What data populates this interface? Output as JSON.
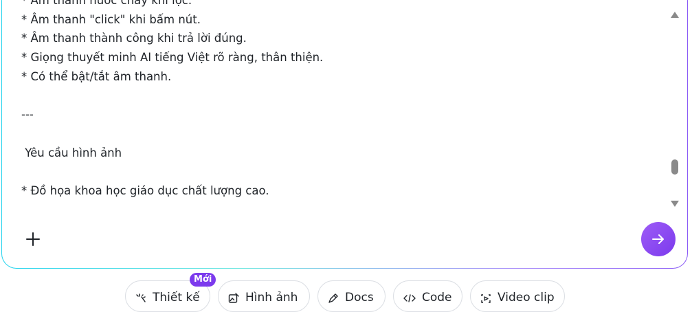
{
  "composer": {
    "lines": [
      "* Âm thanh nước chảy khi lọc.",
      "* Âm thanh \"click\" khi bấm nút.",
      "* Âm thanh thành công khi trả lời đúng.",
      "* Giọng thuyết minh AI tiếng Việt rõ ràng, thân thiện.",
      "* Có thể bật/tắt âm thanh.",
      "",
      "---",
      "",
      " Yêu cầu hình ảnh",
      "",
      "* Đồ họa khoa học giáo dục chất lượng cao."
    ],
    "accent_color": "#7c3aed"
  },
  "chips": [
    {
      "label": "Thiết kế",
      "icon": "sparkle-icon"
    },
    {
      "label": "Hình ảnh",
      "icon": "image-edit-icon"
    },
    {
      "label": "Docs",
      "icon": "pen-icon"
    },
    {
      "label": "Code",
      "icon": "code-icon"
    },
    {
      "label": "Video clip",
      "icon": "video-icon"
    }
  ],
  "badge": {
    "label": "Mới"
  }
}
